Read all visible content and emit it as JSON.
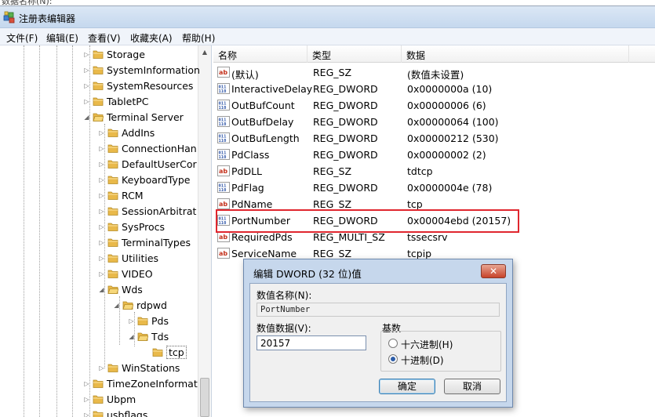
{
  "top_strip_text": "数据名称(N):",
  "window": {
    "title": "注册表编辑器"
  },
  "menu": [
    "文件(F)",
    "编辑(E)",
    "查看(V)",
    "收藏夹(A)",
    "帮助(H)"
  ],
  "tree": {
    "items": [
      {
        "label": "Storage",
        "depth": 0
      },
      {
        "label": "SystemInformation",
        "depth": 0
      },
      {
        "label": "SystemResources",
        "depth": 0
      },
      {
        "label": "TabletPC",
        "depth": 0
      },
      {
        "label": "Terminal Server",
        "depth": 0
      },
      {
        "label": "AddIns",
        "depth": 1
      },
      {
        "label": "ConnectionHan",
        "depth": 1
      },
      {
        "label": "DefaultUserCor",
        "depth": 1
      },
      {
        "label": "KeyboardType",
        "depth": 1
      },
      {
        "label": "RCM",
        "depth": 1
      },
      {
        "label": "SessionArbitrat",
        "depth": 1
      },
      {
        "label": "SysProcs",
        "depth": 1
      },
      {
        "label": "TerminalTypes",
        "depth": 1
      },
      {
        "label": "Utilities",
        "depth": 1
      },
      {
        "label": "VIDEO",
        "depth": 1
      },
      {
        "label": "Wds",
        "depth": 1
      },
      {
        "label": "rdpwd",
        "depth": 2
      },
      {
        "label": "Pds",
        "depth": 3
      },
      {
        "label": "Tds",
        "depth": 3
      },
      {
        "label": "tcp",
        "depth": 4
      },
      {
        "label": "WinStations",
        "depth": 1
      },
      {
        "label": "TimeZoneInformat",
        "depth": 0
      },
      {
        "label": "Ubpm",
        "depth": 0
      },
      {
        "label": "usbflags",
        "depth": 0
      }
    ]
  },
  "list": {
    "headers": [
      "名称",
      "类型",
      "数据"
    ],
    "rows": [
      {
        "name": "(默认)",
        "type": "REG_SZ",
        "data": "(数值未设置)",
        "icon": "string-value-icon"
      },
      {
        "name": "InteractiveDelay",
        "type": "REG_DWORD",
        "data": "0x0000000a (10)",
        "icon": "binary-value-icon"
      },
      {
        "name": "OutBufCount",
        "type": "REG_DWORD",
        "data": "0x00000006 (6)",
        "icon": "binary-value-icon"
      },
      {
        "name": "OutBufDelay",
        "type": "REG_DWORD",
        "data": "0x00000064 (100)",
        "icon": "binary-value-icon"
      },
      {
        "name": "OutBufLength",
        "type": "REG_DWORD",
        "data": "0x00000212 (530)",
        "icon": "binary-value-icon"
      },
      {
        "name": "PdClass",
        "type": "REG_DWORD",
        "data": "0x00000002 (2)",
        "icon": "binary-value-icon"
      },
      {
        "name": "PdDLL",
        "type": "REG_SZ",
        "data": "tdtcp",
        "icon": "string-value-icon"
      },
      {
        "name": "PdFlag",
        "type": "REG_DWORD",
        "data": "0x0000004e (78)",
        "icon": "binary-value-icon"
      },
      {
        "name": "PdName",
        "type": "REG_SZ",
        "data": "tcp",
        "icon": "string-value-icon"
      },
      {
        "name": "PortNumber",
        "type": "REG_DWORD",
        "data": "0x00004ebd (20157)",
        "icon": "binary-value-icon"
      },
      {
        "name": "RequiredPds",
        "type": "REG_MULTI_SZ",
        "data": "tssecsrv",
        "icon": "string-value-icon"
      },
      {
        "name": "ServiceName",
        "type": "REG_SZ",
        "data": "tcpip",
        "icon": "string-value-icon"
      }
    ]
  },
  "dialog": {
    "title": "编辑 DWORD (32 位)值",
    "close_label": "✕",
    "name_label": "数值名称(N):",
    "name_value": "PortNumber",
    "data_label": "数值数据(V):",
    "data_value": "20157",
    "base_label": "基数",
    "hex_label": "十六进制(H)",
    "dec_label": "十进制(D)",
    "ok_label": "确定",
    "cancel_label": "取消"
  },
  "colors": {
    "highlight_border": "#e0262e",
    "folder": "#e9b94a"
  }
}
